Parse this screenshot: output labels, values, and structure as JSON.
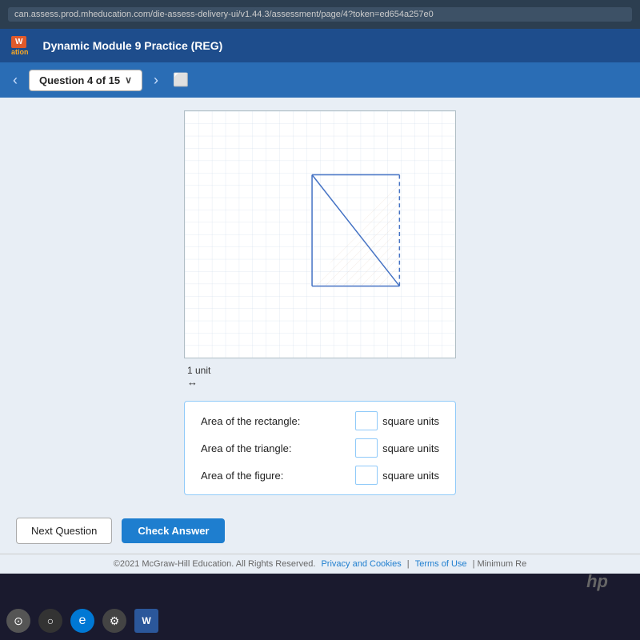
{
  "browser": {
    "url": "can.assess.prod.mheducation.com/die-assess-delivery-ui/v1.44.3/assessment/page/4?token=ed654a257e0"
  },
  "header": {
    "logo_text": "W",
    "logo_sub": "ation",
    "title": "Dynamic Module 9 Practice (REG)"
  },
  "nav": {
    "question_label": "Question 4 of 15",
    "chevron": "∨"
  },
  "graph": {
    "unit_label": "1 unit",
    "unit_arrow": "↔"
  },
  "answers": {
    "rectangle_label": "Area of the rectangle:",
    "triangle_label": "Area of the triangle:",
    "figure_label": "Area of the figure:",
    "unit": "square units",
    "rectangle_value": "",
    "triangle_value": "",
    "figure_value": ""
  },
  "buttons": {
    "next_label": "Next Question",
    "check_label": "Check Answer"
  },
  "footer": {
    "copyright": "©2021 McGraw-Hill Education. All Rights Reserved.",
    "privacy": "Privacy and Cookies",
    "terms": "Terms of Use",
    "minimum": "Minimum Re"
  }
}
